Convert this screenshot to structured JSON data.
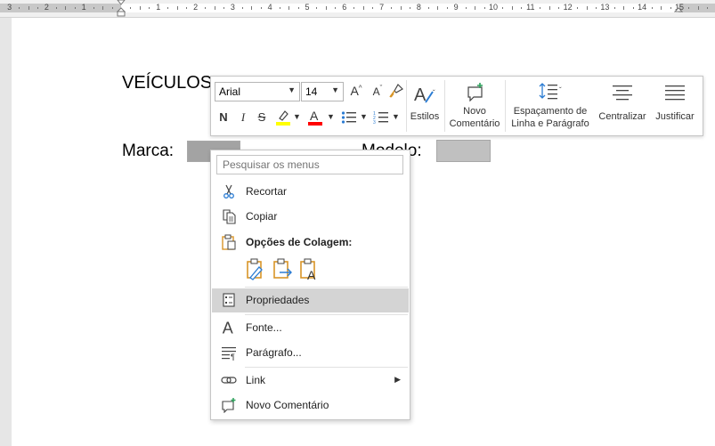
{
  "ruler": {
    "numbers": [
      "3",
      "2",
      "1",
      "1",
      "2",
      "3",
      "4",
      "5",
      "6",
      "7",
      "8",
      "9",
      "10",
      "11",
      "12",
      "13",
      "14",
      "15"
    ]
  },
  "document": {
    "heading": "VEÍCULOS",
    "marca_label": "Marca:",
    "modelo_label": "Modelo:"
  },
  "mini_toolbar": {
    "font_name": "Arial",
    "font_size": "14",
    "grow_font": "A",
    "shrink_font": "A",
    "bold": "N",
    "italic": "I",
    "strike": "S",
    "highlight_color": "#ffff00",
    "font_color": "#ff0000",
    "styles_label": "Estilos",
    "new_comment_label": [
      "Novo",
      "Comentário"
    ],
    "line_spacing_label": [
      "Espaçamento de",
      "Linha e Parágrafo"
    ],
    "center_label": "Centralizar",
    "justify_label": "Justificar"
  },
  "context_menu": {
    "search_placeholder": "Pesquisar os menus",
    "cut": "Recortar",
    "copy": "Copiar",
    "paste_options": "Opções de Colagem:",
    "properties": "Propriedades",
    "font": "Fonte...",
    "paragraph": "Parágrafo...",
    "link": "Link",
    "new_comment": "Novo Comentário"
  },
  "colors": {
    "accent_blue": "#2b7cd3",
    "paste_orange": "#d89528",
    "hover_gray": "#d4d4d4"
  }
}
